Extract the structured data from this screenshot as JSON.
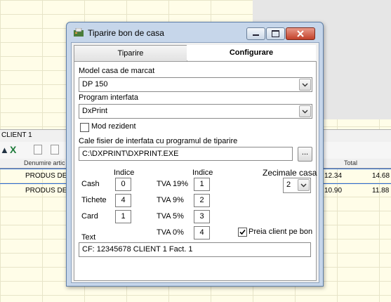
{
  "background_app": {
    "bar_label": "CLIENT 1",
    "columns": {
      "denumire": "Denumire artic",
      "total": "Total"
    },
    "rows": [
      {
        "name": "PRODUS DE",
        "price": "12.34",
        "total": "14.68"
      },
      {
        "name": "PRODUS DE",
        "price": "10.90",
        "total": "11.88"
      }
    ]
  },
  "dialog": {
    "title": "Tiparire bon de casa",
    "tabs": [
      {
        "label": "Tiparire",
        "active": false
      },
      {
        "label": "Configurare",
        "active": true
      }
    ],
    "model_label": "Model casa de marcat",
    "model_value": "DP 150",
    "program_label": "Program interfata",
    "program_value": "DxPrint",
    "mod_rezident_label": "Mod rezident",
    "mod_rezident_checked": false,
    "path_label": "Cale fisier de interfata cu programul de tiparire",
    "path_value": "C:\\DXPRINT\\DXPRINT.EXE",
    "browse_label": "...",
    "indice_label_1": "Indice",
    "indice_label_2": "Indice",
    "payments": [
      {
        "label": "Cash",
        "value": "0"
      },
      {
        "label": "Tichete",
        "value": "4"
      },
      {
        "label": "Card",
        "value": "1"
      }
    ],
    "vat": [
      {
        "label": "TVA 19%",
        "value": "1"
      },
      {
        "label": "TVA 9%",
        "value": "2"
      },
      {
        "label": "TVA 5%",
        "value": "3"
      },
      {
        "label": "TVA 0%",
        "value": "4"
      }
    ],
    "zecimale_label": "Zecimale casa",
    "zecimale_value": "2",
    "preia_label": "Preia client pe bon",
    "preia_checked": true,
    "text_label": "Text",
    "text_value": "CF: 12345678 CLIENT 1 Fact. 1"
  }
}
